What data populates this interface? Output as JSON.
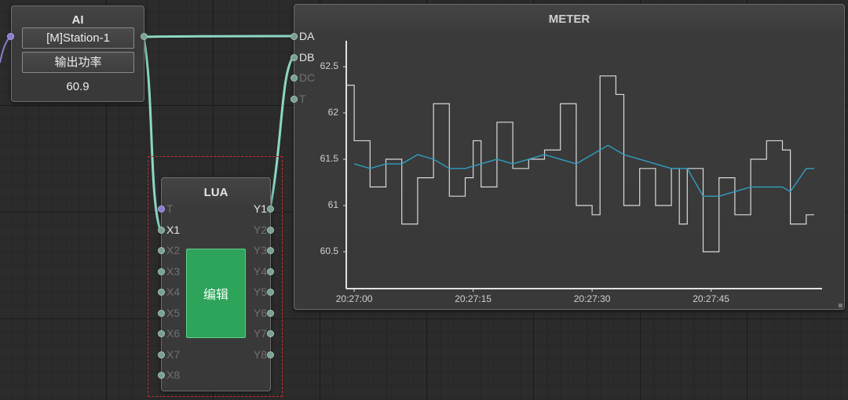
{
  "ai_node": {
    "title": "AI",
    "station": "[M]Station-1",
    "metric": "输出功率",
    "value": "60.9"
  },
  "lua_node": {
    "title": "LUA",
    "edit_label": "编辑",
    "inputs": [
      "T",
      "X1",
      "X2",
      "X3",
      "X4",
      "X5",
      "X6",
      "X7",
      "X8"
    ],
    "outputs": [
      "Y1",
      "Y2",
      "Y3",
      "Y4",
      "Y5",
      "Y6",
      "Y7",
      "Y8"
    ],
    "active_inputs": [
      "X1"
    ],
    "active_outputs": [
      "Y1"
    ]
  },
  "meter_node": {
    "title": "METER",
    "inputs": [
      "DA",
      "DB",
      "DC",
      "T"
    ],
    "active_inputs": [
      "DA",
      "DB"
    ]
  },
  "colors": {
    "wire": "#8dd7c4",
    "raw_series": "#d9d9d9",
    "avg_series": "#2f9fc1",
    "selection": "#c8282a",
    "edit_button": "#2ea35a"
  },
  "chart_data": {
    "type": "line",
    "title": "METER",
    "ylim": [
      60.5,
      62.5
    ],
    "y_ticks": [
      "60.5",
      "61",
      "61.5",
      "62",
      "62.5"
    ],
    "x_ticks": [
      "20:27:00",
      "20:27:15",
      "20:27:30",
      "20:27:45"
    ],
    "x_tick_seconds": [
      0,
      15,
      30,
      45
    ],
    "xlim_seconds": [
      -1,
      59
    ],
    "series": [
      {
        "style": "step",
        "x": [
          -1,
          0,
          2,
          4,
          6,
          8,
          10,
          12,
          14,
          15,
          16,
          18,
          20,
          22,
          24,
          26,
          28,
          30,
          31,
          33,
          34,
          36,
          38,
          40,
          41,
          42,
          44,
          46,
          48,
          50,
          52,
          54,
          55,
          57
        ],
        "y": [
          62.3,
          61.7,
          61.2,
          61.5,
          60.8,
          61.3,
          62.1,
          61.1,
          61.3,
          61.7,
          61.2,
          61.9,
          61.4,
          61.5,
          61.6,
          62.1,
          61.0,
          60.9,
          62.4,
          62.2,
          61.0,
          61.4,
          61.0,
          61.4,
          60.8,
          61.4,
          60.5,
          61.3,
          60.9,
          61.5,
          61.7,
          61.6,
          60.8,
          60.9
        ]
      },
      {
        "style": "line",
        "x": [
          0,
          2,
          4,
          6,
          8,
          10,
          12,
          14,
          16,
          18,
          20,
          22,
          24,
          26,
          28,
          30,
          32,
          34,
          36,
          38,
          40,
          42,
          44,
          46,
          48,
          50,
          52,
          54,
          55,
          57,
          58
        ],
        "y": [
          61.45,
          61.4,
          61.45,
          61.45,
          61.55,
          61.5,
          61.4,
          61.4,
          61.45,
          61.5,
          61.45,
          61.5,
          61.55,
          61.5,
          61.45,
          61.55,
          61.65,
          61.55,
          61.5,
          61.45,
          61.4,
          61.4,
          61.1,
          61.1,
          61.15,
          61.2,
          61.2,
          61.2,
          61.15,
          61.4,
          61.4
        ]
      }
    ]
  }
}
